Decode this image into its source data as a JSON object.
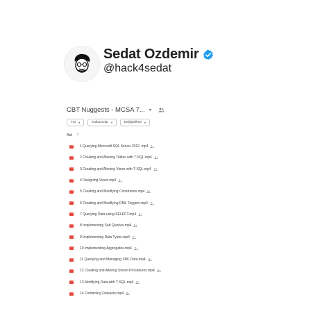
{
  "profile": {
    "display_name": "Sedat Ozdemir",
    "handle": "@hack4sedat",
    "verified_color": "#1d9bf0"
  },
  "folder": {
    "title": "CBT Nuggests - MCSA 7...",
    "caret": "▾",
    "share_icon": "shared-people-icon"
  },
  "filters": [
    {
      "label": "Tür",
      "arrow": "▾"
    },
    {
      "label": "Kullanıcılar",
      "arrow": "▾"
    },
    {
      "label": "Değiştirilme",
      "arrow": "▾"
    }
  ],
  "column": {
    "label": "Adı",
    "sort": "↑"
  },
  "files": [
    "1 Querying Microsoft SQL Server 2012 .mp4",
    "2 Creating and Altering Tables with T-SQL.mp4",
    "3 Creating and Altering Views with T-SQL.mp4",
    "4 Designing Views.mp4",
    "5 Creating and Modifying Constraints.mp4",
    "6 Creating and Modifying DML Triggers.mp4",
    "7 Querying Data using SELECT.mp4",
    "8 Implementing Sub Queries.mp4",
    "9 Implementing Data Types.mp4",
    "10 Implementing Aggregates.mp4",
    "11 Querying and Managing XML Data.mp4",
    "12 Creating and Altering Stored Procedures.mp4",
    "13 Modifying Data with T-SQL.mp4",
    "14 Combining Datasets.mp4"
  ],
  "colors": {
    "video_icon": "#e5443a",
    "text": "#3c4043"
  }
}
